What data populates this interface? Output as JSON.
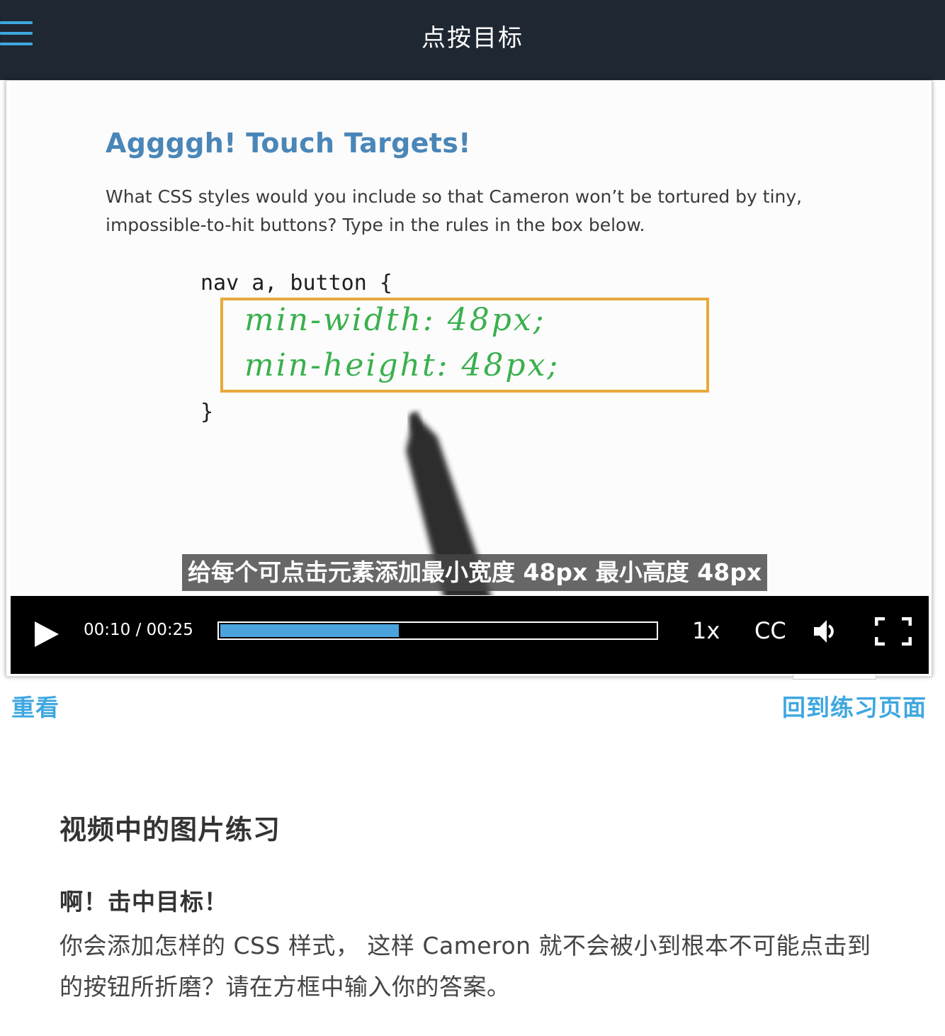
{
  "header": {
    "title": "点按目标",
    "menu_icon": "hamburger-menu-icon"
  },
  "video": {
    "slide": {
      "heading": "Aggggh! Touch Targets!",
      "question": "What CSS styles would you include so that Cameron won’t be tortured by tiny, impossible-to-hit buttons? Type in the rules in the box below.",
      "code_open": "nav a, button {",
      "code_close": "}",
      "handwritten_line1": "min-width: 48px;",
      "handwritten_line2": "min-height: 48px;"
    },
    "subtitle": "给每个可点击元素添加最小宽度 48px 最小高度 48px",
    "controls": {
      "play_icon": "play-icon",
      "time": "00:10 / 00:25",
      "progress": 0.41,
      "speed": "1x",
      "captions": "CC",
      "volume_icon": "volume-icon",
      "fullscreen_icon": "fullscreen-icon"
    },
    "colors": {
      "accent": "#3fa7e0",
      "progress_fill": "#4aa3dd",
      "box_border": "#e8a93b",
      "handwriting": "#3ab04e",
      "slide_heading": "#4a86b8"
    }
  },
  "links": {
    "rewatch": "重看",
    "back_to_exercise": "回到练习页面"
  },
  "exercise": {
    "section_title": "视频中的图片练习",
    "question_title": "啊！击中目标！",
    "question_body": "你会添加怎样的 CSS 样式， 这样 Cameron 就不会被小到根本不可能点击到的按钮所折磨？请在方框中输入你的答案。"
  }
}
